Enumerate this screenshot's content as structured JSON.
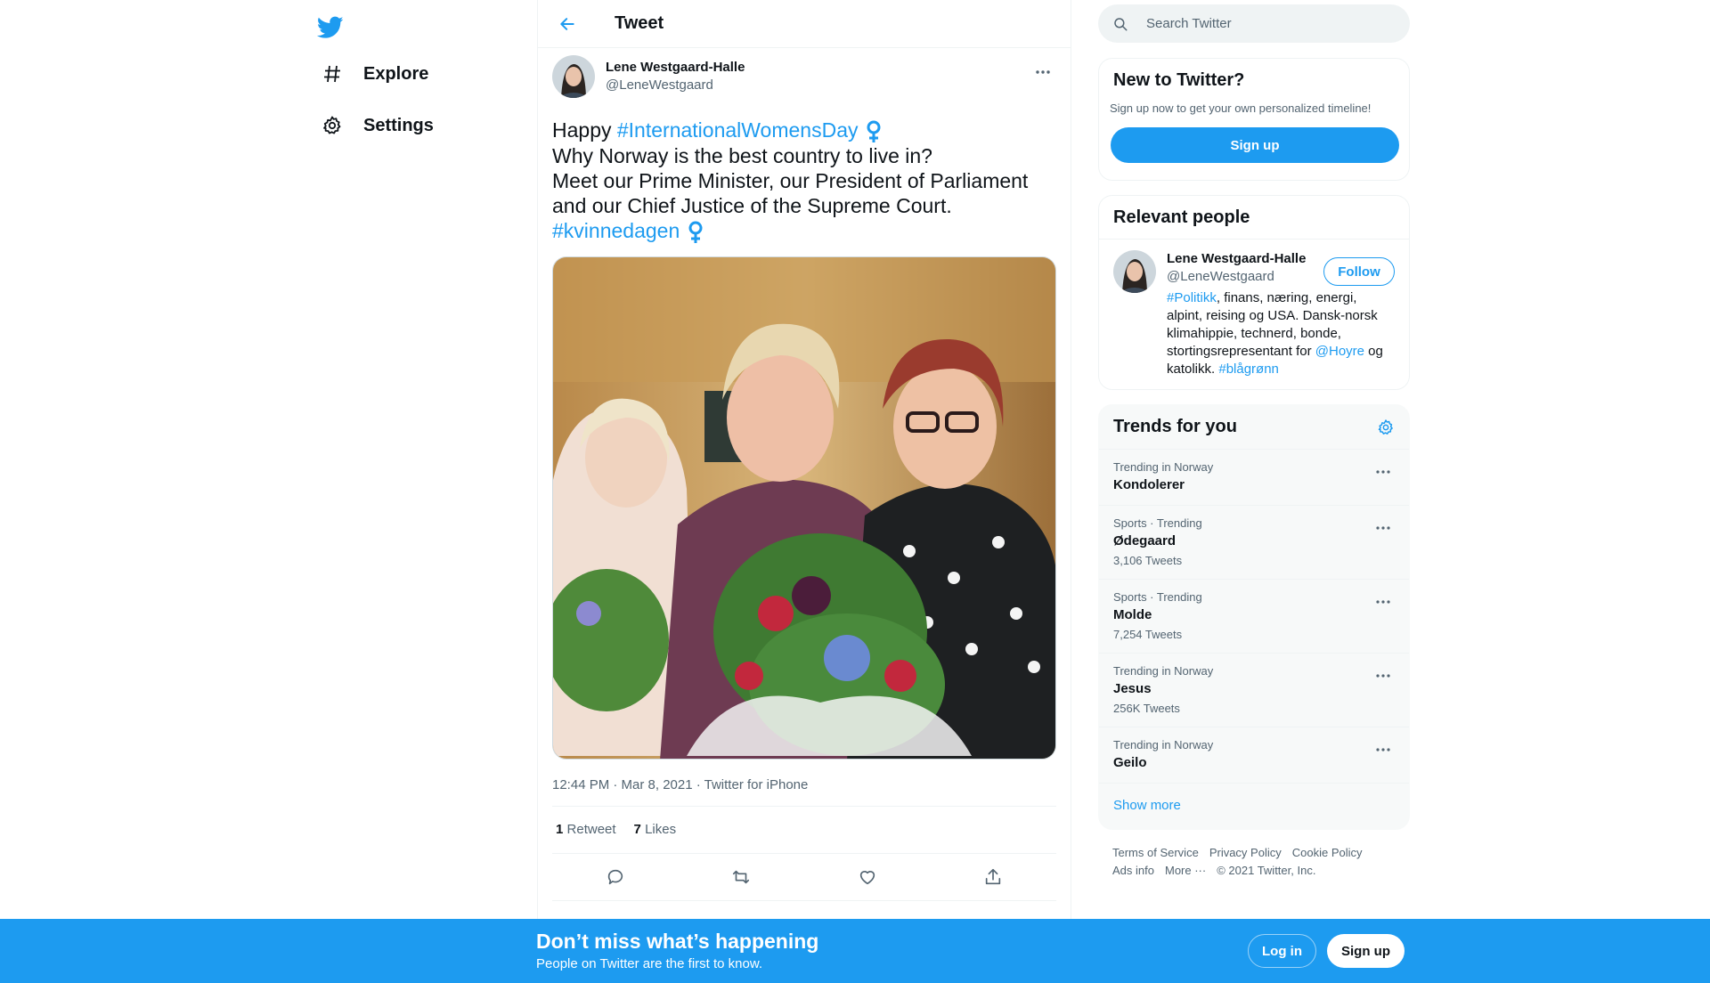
{
  "colors": {
    "accent": "#1d9bf0",
    "text": "#0f1419",
    "muted": "#536471"
  },
  "nav": {
    "logo_icon": "twitter-bird-icon",
    "items": [
      {
        "label": "Explore",
        "icon": "hashtag-icon"
      },
      {
        "label": "Settings",
        "icon": "gear-icon"
      }
    ]
  },
  "header": {
    "title": "Tweet"
  },
  "tweet": {
    "author_name": "Lene Westgaard-Halle",
    "author_handle": "@LeneWestgaard",
    "text": {
      "happy": "Happy ",
      "hashtag1": "#InternationalWomensDay",
      "line2": "Why Norway is the best country to live in?",
      "line3": "Meet our Prime Minister, our President of Parliament",
      "line4": "and our Chief Justice of the Supreme Court.",
      "hashtag2": "#kvinnedagen"
    },
    "timestamp": "12:44 PM · Mar 8, 2021 · Twitter for iPhone",
    "retweet_count": "1",
    "retweet_label": "Retweet",
    "like_count": "7",
    "like_label": "Likes"
  },
  "search": {
    "placeholder": "Search Twitter"
  },
  "new_to_twitter": {
    "title": "New to Twitter?",
    "subtitle": "Sign up now to get your own personalized timeline!",
    "signup_label": "Sign up"
  },
  "relevant_people": {
    "title": "Relevant people",
    "name": "Lene Westgaard-Halle",
    "handle": "@LeneWestgaard",
    "follow_label": "Follow",
    "bio": {
      "tag1": "#Politikk",
      "text1": ", finans, næring, energi, alpint, reising og USA. Dansk-norsk klimahippie, technerd, bonde, stortingsrepresentant for ",
      "mention": "@Hoyre",
      "text2": " og katolikk. ",
      "tag2": "#blågrønn"
    }
  },
  "trends": {
    "title": "Trends for you",
    "items": [
      {
        "context": "Trending in Norway",
        "name": "Kondolerer",
        "count": ""
      },
      {
        "context": "Sports · Trending",
        "name": "Ødegaard",
        "count": "3,106 Tweets"
      },
      {
        "context": "Sports · Trending",
        "name": "Molde",
        "count": "7,254 Tweets"
      },
      {
        "context": "Trending in Norway",
        "name": "Jesus",
        "count": "256K Tweets"
      },
      {
        "context": "Trending in Norway",
        "name": "Geilo",
        "count": ""
      }
    ],
    "show_more": "Show more"
  },
  "footer": {
    "terms": "Terms of Service",
    "privacy": "Privacy Policy",
    "cookie": "Cookie Policy",
    "ads": "Ads info",
    "more": "More ···",
    "copyright": "© 2021 Twitter, Inc."
  },
  "bottom_bar": {
    "title": "Don’t miss what’s happening",
    "subtitle": "People on Twitter are the first to know.",
    "login_label": "Log in",
    "signup_label": "Sign up"
  }
}
